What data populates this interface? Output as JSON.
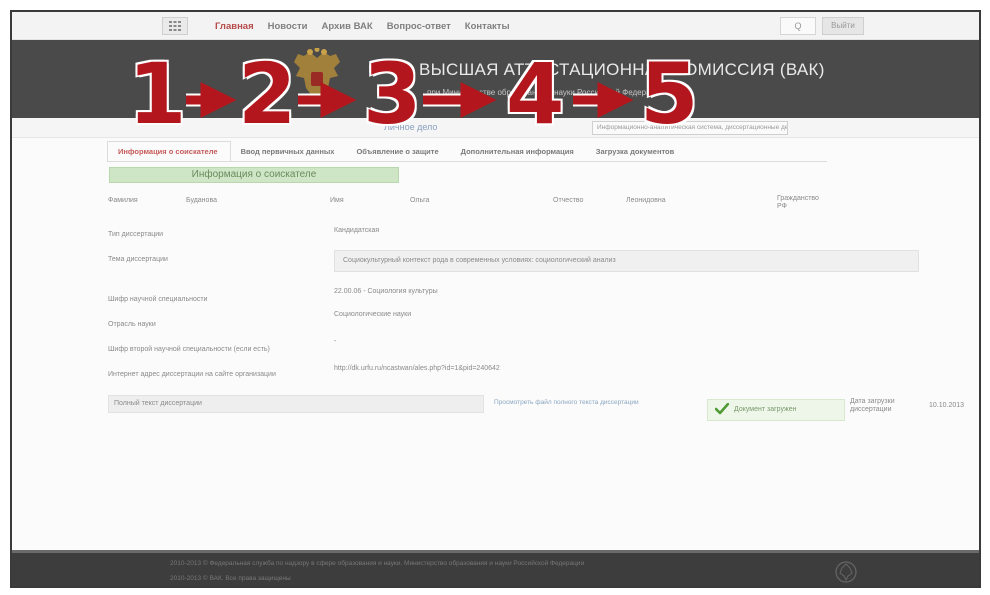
{
  "nav": {
    "grid_icon": "grid-icon",
    "links": [
      "Главная",
      "Новости",
      "Архив ВАК",
      "Вопрос-ответ",
      "Контакты"
    ],
    "active_index": 0,
    "search_glyph": "Q",
    "login_label": "Выйти"
  },
  "header": {
    "title": "ВЫСШАЯ АТТЕСТАЦИОННАЯ КОМИССИЯ (ВАК)",
    "subtitle": "при Министерстве образования и науки Российской Федерации",
    "emblem_icon": "double-headed-eagle-icon"
  },
  "substrip": {
    "link": "Личное дело",
    "box_text": "Информационно-аналитическая система, диссертационные дела"
  },
  "tabs": [
    {
      "label": "Информация о соискателе",
      "active": true
    },
    {
      "label": "Ввод первичных данных",
      "active": false
    },
    {
      "label": "Объявление о защите",
      "active": false
    },
    {
      "label": "Дополнительная информация",
      "active": false
    },
    {
      "label": "Загрузка документов",
      "active": false
    }
  ],
  "section": {
    "title": "Информация о соискателе"
  },
  "person": {
    "surname_label": "Фамилия",
    "surname_value": "Буданова",
    "name_label": "Имя",
    "name_value": "Ольга",
    "patronymic_label": "Отчество",
    "patronymic_value": "Леонидовна",
    "citizenship_label": "Гражданство РФ"
  },
  "fields": [
    {
      "label": "Тип диссертации",
      "value": "Кандидатская"
    },
    {
      "label": "Тема диссертации",
      "value": "Социокультурный контекст рода в современных условиях: социологический анализ"
    },
    {
      "label": "Шифр научной специальности",
      "value": "22.00.06 - Социология культуры"
    },
    {
      "label": "Отрасль науки",
      "value": "Социологические науки"
    },
    {
      "label": "Шифр второй научной специальности (если есть)",
      "value": "-"
    },
    {
      "label": "Интернет адрес диссертации на сайте организации",
      "value": "http://dk.urfu.ru/ncastwan/ales.php?id=1&pid=240642"
    }
  ],
  "fulltext": {
    "label": "Полный текст диссертации",
    "view_link": "Просмотреть файл полного текста диссертации",
    "badge": "Документ загружен",
    "check_icon": "check-icon",
    "date_label": "Дата загрузки диссертации",
    "date_value": "10.10.2013"
  },
  "footer": {
    "line1": "2010-2013 © Федеральная служба по надзору в сфере образования и науки. Министерство образования и науки Российской Федерации",
    "line2": "2010-2013 © ВАК. Все права защищены",
    "emblem_icon": "emblem-icon"
  },
  "steps": {
    "numbers": [
      "1",
      "2",
      "3",
      "4",
      "5"
    ],
    "color": "#b3171d",
    "arrow_icon": "right-arrow-icon"
  }
}
